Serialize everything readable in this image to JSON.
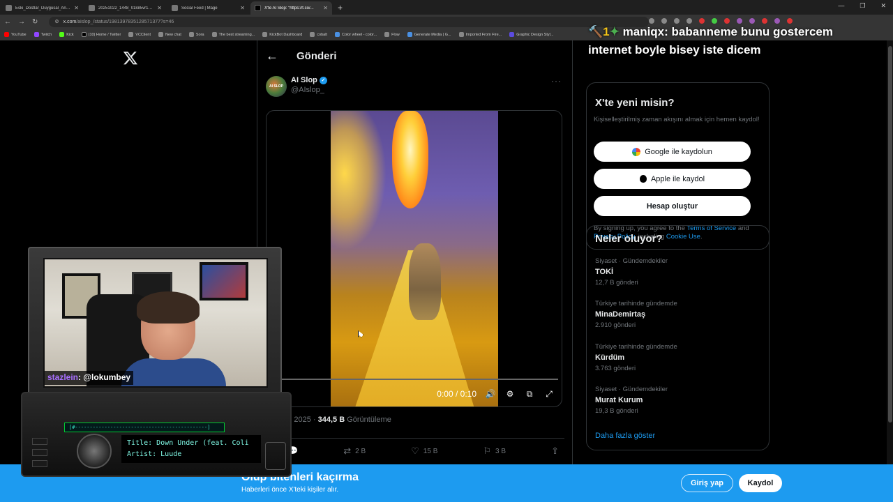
{
  "browser": {
    "tabs": [
      {
        "title": "Eski_Dostlar_Duygusal_Ans.m..."
      },
      {
        "title": "20251022_1448_01k85vr1xmq..."
      },
      {
        "title": "Social Feed | Mage"
      },
      {
        "title": "X'te AI Slop: \"https://t.co/..."
      }
    ],
    "new_tab": "+",
    "url_domain": "x.com",
    "url_path": "/aislop_/status/1981397835128571377?s=46",
    "bookmarks": [
      "YouTube",
      "Twitch",
      "Kick",
      "(10) Home / Twitter",
      "VCClient",
      "New chat",
      "Sora",
      "The best streaming...",
      "KickBot Dashboard",
      "cobalt",
      "Color wheel - color...",
      "Flow",
      "Generate Media | G...",
      "Imported From Fire...",
      "Graphic Design Styl..."
    ]
  },
  "stream_overlay": {
    "line1_prefix": "1",
    "line1_nick": "maniqx",
    "line1_text": ": babanneme bunu gostercem",
    "line2": "internet boyle bisey iste dicem"
  },
  "post": {
    "header_title": "Gönderi",
    "author_name": "AI Slop",
    "author_handle": "@AIslop_",
    "avatar_text": "AI SLOP",
    "video_time": "0:00 / 0:10",
    "meta_date": "23 Eki 2025",
    "views_value": "344,5 B",
    "views_label": "Görüntüleme",
    "reposts": "2 B",
    "likes": "15 B",
    "bookmarks": "3 B"
  },
  "signup": {
    "title": "X'te yeni misin?",
    "desc": "Kişiselleştirilmiş zaman akışını almak için hemen kaydol!",
    "google": "Google ile kaydolun",
    "apple": "Apple ile kaydol",
    "create": "Hesap oluştur",
    "terms_1": "By signing up, you agree to the ",
    "terms_link1": "Terms of Service",
    "terms_2": " and ",
    "terms_link2": "Privacy Policy",
    "terms_3": ", including ",
    "terms_link3": "Cookie Use",
    "terms_4": "."
  },
  "trends": {
    "title": "Neler oluyor?",
    "items": [
      {
        "context": "Siyaset · Gündemdekiler",
        "name": "TOKİ",
        "count": "12,7 B gönderi"
      },
      {
        "context": "Türkiye tarihinde gündemde",
        "name": "MinaDemirtaş",
        "count": "2.910 gönderi"
      },
      {
        "context": "Türkiye tarihinde gündemde",
        "name": "Kürdüm",
        "count": "3.763 gönderi"
      },
      {
        "context": "Siyaset · Gündemdekiler",
        "name": "Murat Kurum",
        "count": "19,3 B gönderi"
      }
    ],
    "show_more": "Daha fazla göster"
  },
  "banner": {
    "title": "Olup bitenleri kaçırma",
    "subtitle": "Haberleri önce X'teki kişiler alır.",
    "login": "Giriş yap",
    "signup": "Kaydol"
  },
  "webcam": {
    "tag_prefix": "stazlein",
    "tag_text": ": @lokumbey"
  },
  "radio": {
    "strip": "[#---------------------------------------------]",
    "title_line": "Title: Down Under (feat. Coli",
    "artist_line": "Artist: Luude"
  },
  "colors": {
    "accent": "#1d9bf0",
    "bg": "#000000",
    "muted": "#71767b"
  }
}
